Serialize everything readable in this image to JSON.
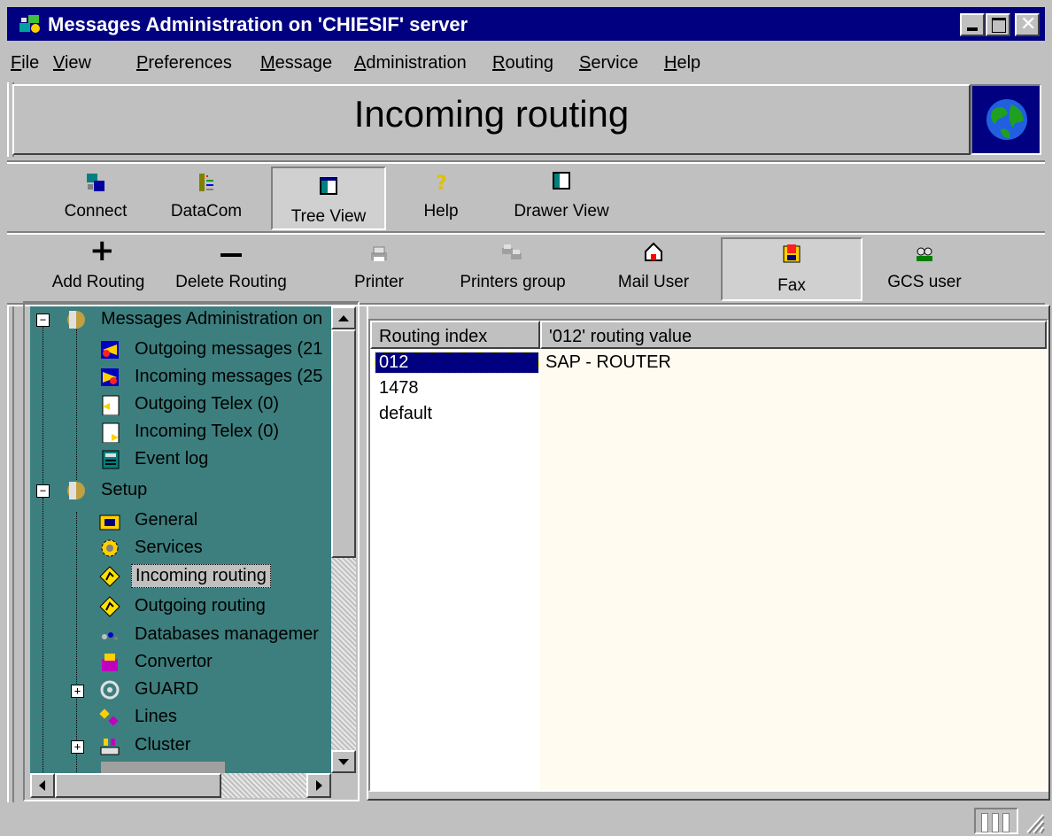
{
  "window": {
    "title": "Messages Administration on 'CHIESIF' server",
    "controls": [
      "minimize",
      "maximize",
      "close"
    ]
  },
  "menu": [
    "File",
    "View",
    "Preferences",
    "Message",
    "Administration",
    "Routing",
    "Service",
    "Help"
  ],
  "header": {
    "title": "Incoming routing",
    "icon": "globe-icon"
  },
  "toolbar1": [
    {
      "label": "Connect",
      "icon": "connect-icon"
    },
    {
      "label": "DataCom",
      "icon": "datacom-icon"
    },
    {
      "label": "Tree View",
      "icon": "tree-view-icon",
      "pressed": true
    },
    {
      "label": "Help",
      "icon": "help-icon"
    },
    {
      "label": "Drawer View",
      "icon": "drawer-view-icon"
    }
  ],
  "toolbar2": [
    {
      "label": "Add Routing",
      "icon": "plus-icon"
    },
    {
      "label": "Delete Routing",
      "icon": "minus-icon"
    },
    {
      "label": "Printer",
      "icon": "printer-icon"
    },
    {
      "label": "Printers group",
      "icon": "printers-group-icon"
    },
    {
      "label": "Mail User",
      "icon": "mail-user-icon"
    },
    {
      "label": "Fax",
      "icon": "fax-icon",
      "pressed": true
    },
    {
      "label": "GCS user",
      "icon": "gcs-user-icon"
    }
  ],
  "tree": [
    {
      "label": "Messages Administration on",
      "icon": "server-icon",
      "level": 0,
      "expander": "-"
    },
    {
      "label": "Outgoing messages (21",
      "icon": "outgoing-messages-icon",
      "level": 1
    },
    {
      "label": "Incoming messages (25",
      "icon": "incoming-messages-icon",
      "level": 1
    },
    {
      "label": "Outgoing Telex (0)",
      "icon": "outgoing-telex-icon",
      "level": 1
    },
    {
      "label": "Incoming Telex (0)",
      "icon": "incoming-telex-icon",
      "level": 1
    },
    {
      "label": "Event log",
      "icon": "event-log-icon",
      "level": 1
    },
    {
      "label": "Setup",
      "icon": "setup-icon",
      "level": 0,
      "expander": "-"
    },
    {
      "label": "General",
      "icon": "general-icon",
      "level": 1
    },
    {
      "label": "Services",
      "icon": "services-icon",
      "level": 1
    },
    {
      "label": "Incoming routing",
      "icon": "routing-icon",
      "level": 1,
      "selected": true
    },
    {
      "label": "Outgoing routing",
      "icon": "routing-icon",
      "level": 1
    },
    {
      "label": "Databases managemer",
      "icon": "databases-icon",
      "level": 1
    },
    {
      "label": "Convertor",
      "icon": "convertor-icon",
      "level": 1
    },
    {
      "label": "GUARD",
      "icon": "guard-icon",
      "level": 1,
      "expander": "+"
    },
    {
      "label": "Lines",
      "icon": "lines-icon",
      "level": 1
    },
    {
      "label": "Cluster",
      "icon": "cluster-icon",
      "level": 1,
      "expander": "+"
    }
  ],
  "table": {
    "columns": [
      "Routing index",
      "'012' routing value"
    ],
    "rows": [
      [
        "012",
        "SAP - ROUTER"
      ],
      [
        "1478",
        ""
      ],
      [
        "default",
        ""
      ]
    ],
    "selected_row": 0
  },
  "colors": {
    "titlebar": "#000080",
    "tree_bg": "#3d7f7f",
    "selection": "#000080",
    "list_bg": "#fffbf0"
  }
}
